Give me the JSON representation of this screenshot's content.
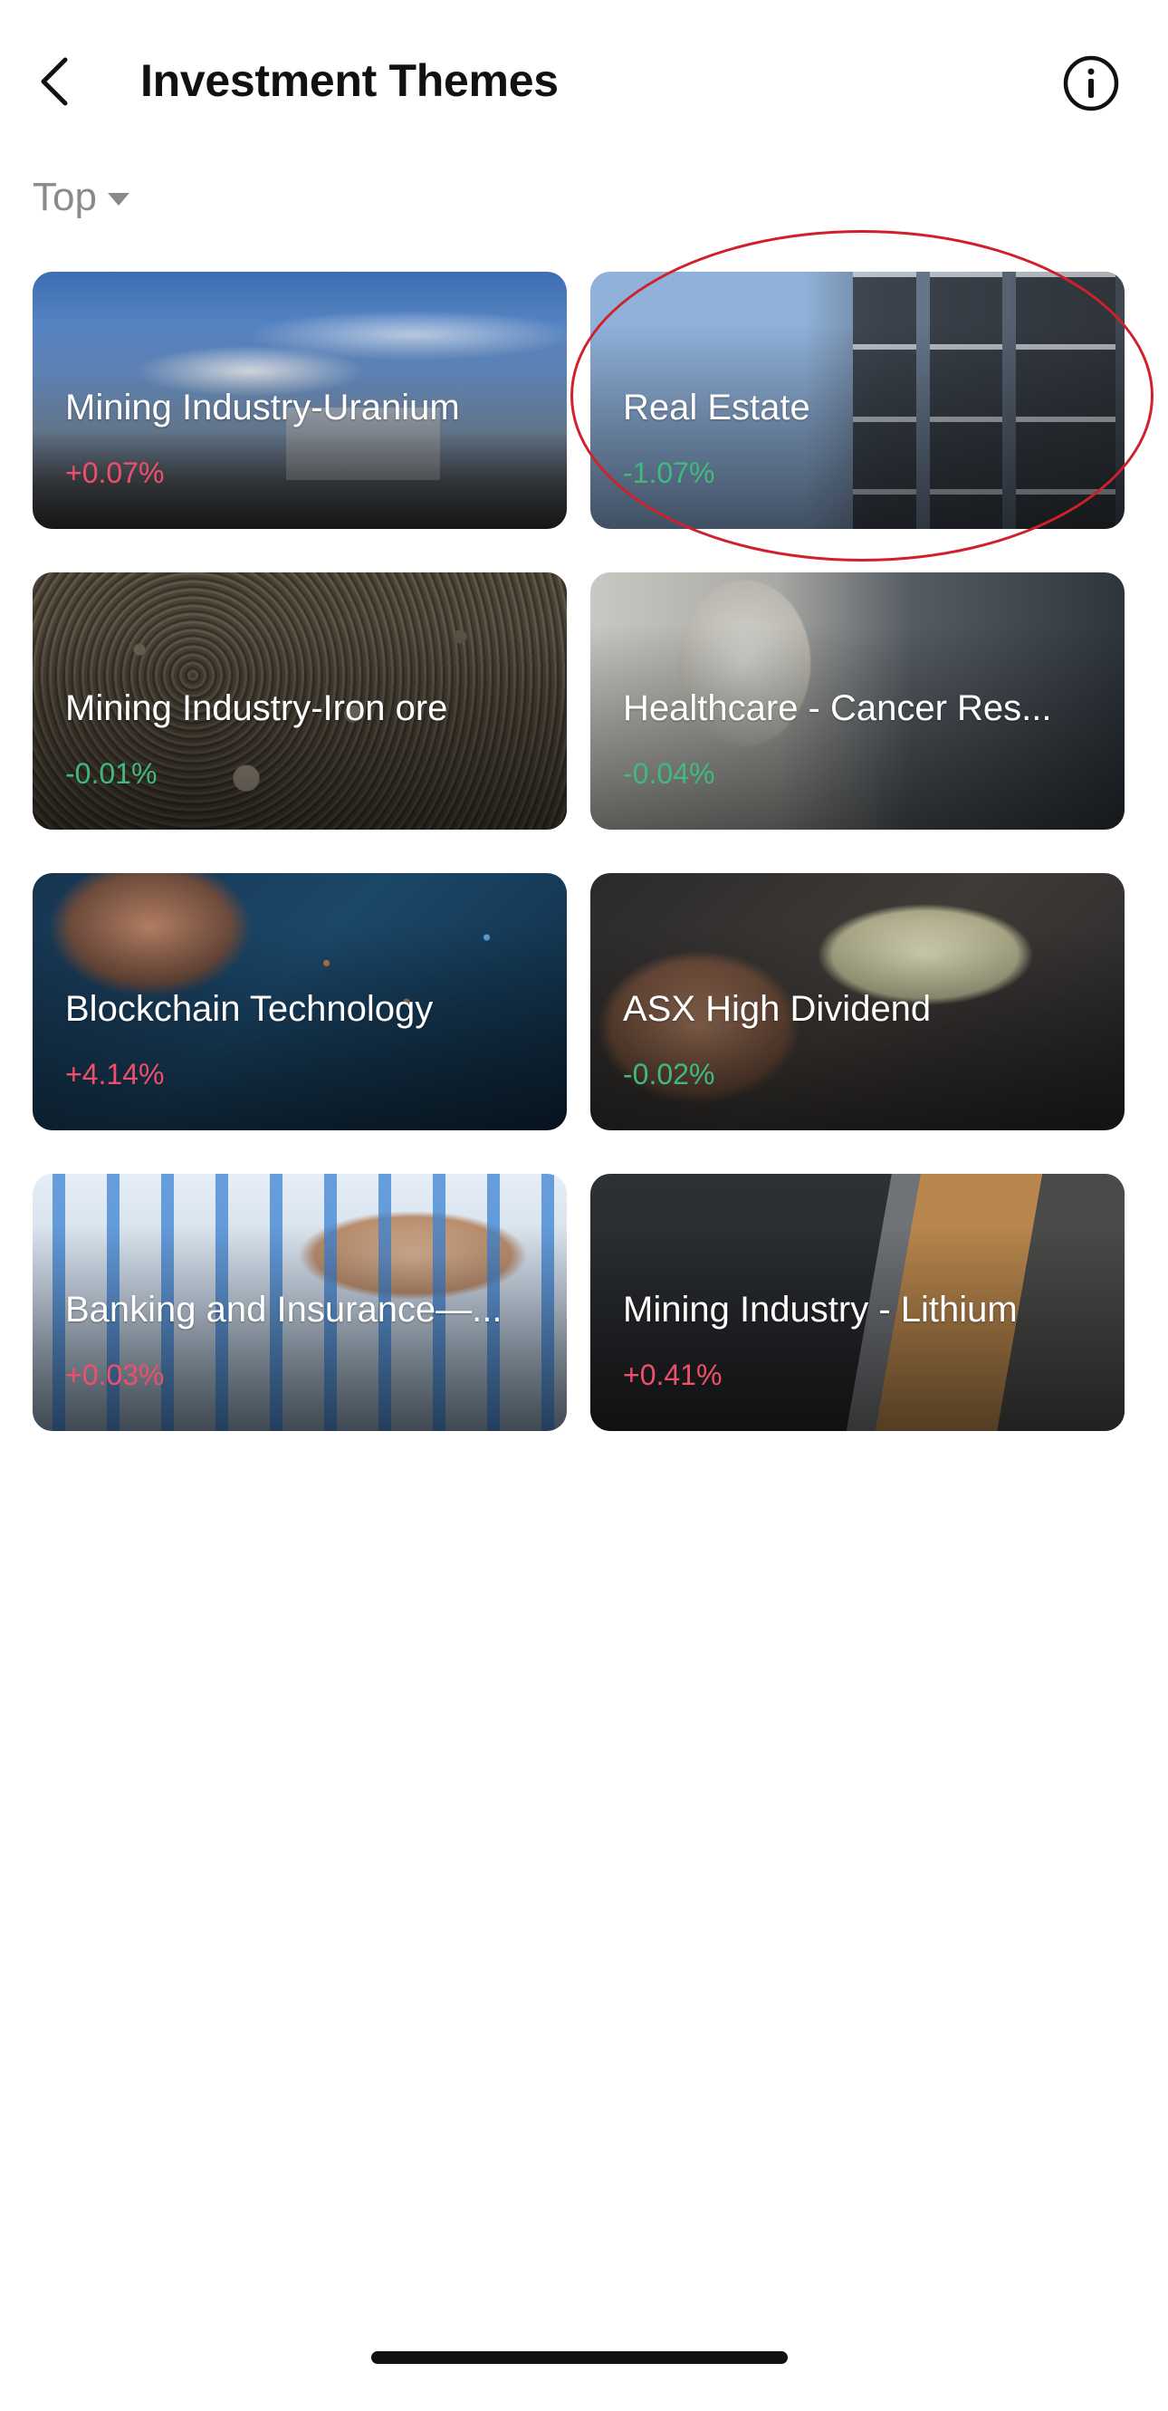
{
  "header": {
    "title": "Investment Themes",
    "back_icon": "chevron-left-icon",
    "info_icon": "info-circle-icon"
  },
  "sort": {
    "selected": "Top"
  },
  "themes": [
    {
      "title": "Mining Industry-Uranium",
      "change": "+0.07%",
      "direction": "up"
    },
    {
      "title": "Real Estate",
      "change": "-1.07%",
      "direction": "down"
    },
    {
      "title": "Mining Industry-Iron ore",
      "change": "-0.01%",
      "direction": "down"
    },
    {
      "title": "Healthcare - Cancer Res...",
      "change": "-0.04%",
      "direction": "down"
    },
    {
      "title": "Blockchain Technology",
      "change": "+4.14%",
      "direction": "up"
    },
    {
      "title": "ASX High Dividend",
      "change": "-0.02%",
      "direction": "down"
    },
    {
      "title": "Banking and Insurance—...",
      "change": "+0.03%",
      "direction": "up"
    },
    {
      "title": "Mining Industry - Lithium",
      "change": "+0.41%",
      "direction": "up"
    }
  ],
  "colors": {
    "up": "#ef4f6a",
    "down": "#3fba7f",
    "highlight": "#d0202c"
  }
}
